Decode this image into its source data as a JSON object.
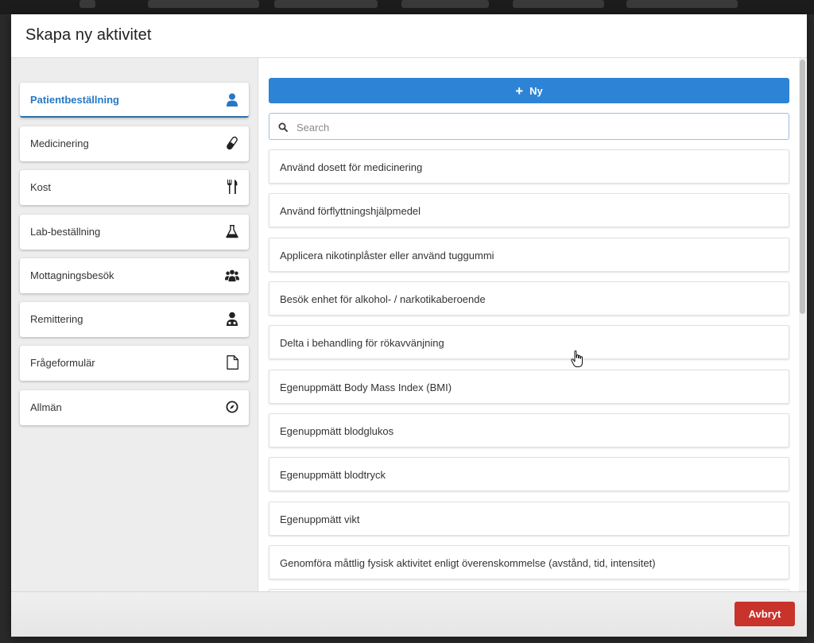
{
  "modal": {
    "title": "Skapa ny aktivitet"
  },
  "categories": [
    {
      "label": "Patientbeställning",
      "icon": "user-icon",
      "active": true
    },
    {
      "label": "Medicinering",
      "icon": "pill-icon",
      "active": false
    },
    {
      "label": "Kost",
      "icon": "cutlery-icon",
      "active": false
    },
    {
      "label": "Lab-beställning",
      "icon": "flask-icon",
      "active": false
    },
    {
      "label": "Mottagningsbesök",
      "icon": "users-group-icon",
      "active": false
    },
    {
      "label": "Remittering",
      "icon": "doctor-icon",
      "active": false
    },
    {
      "label": "Frågeformulär",
      "icon": "document-icon",
      "active": false
    },
    {
      "label": "Allmän",
      "icon": "compass-icon",
      "active": false
    }
  ],
  "toolbar": {
    "new_label": "Ny",
    "search_placeholder": "Search"
  },
  "activities": [
    "Använd dosett för medicinering",
    "Använd förflyttningshjälpmedel",
    "Applicera nikotinplåster eller använd tuggummi",
    "Besök enhet för alkohol- / narkotikaberoende",
    "Delta i behandling för rökavvänjning",
    "Egenuppmätt Body Mass Index (BMI)",
    "Egenuppmätt blodglukos",
    "Egenuppmätt blodtryck",
    "Egenuppmätt vikt",
    "Genomföra måttlig fysisk aktivitet enligt överenskommelse (avstånd, tid, intensitet)",
    ""
  ],
  "footer": {
    "cancel_label": "Avbryt"
  },
  "colors": {
    "accent": "#2d84d6",
    "active_text": "#2778c4",
    "danger": "#c8332c"
  }
}
